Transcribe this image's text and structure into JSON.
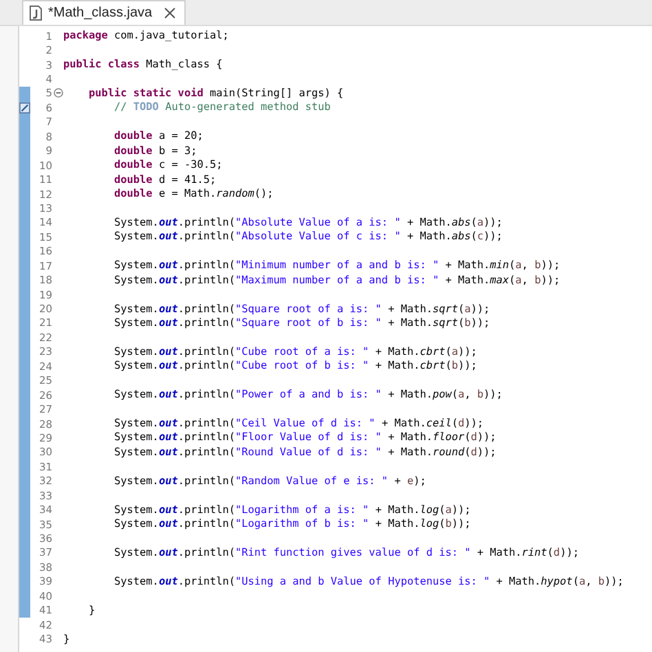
{
  "tabs": [
    {
      "label": "*Math_class.java",
      "selected": true
    }
  ],
  "lines": [
    {
      "number": "1",
      "changed": false,
      "tokens": [
        {
          "kind": "kw",
          "text": "package"
        },
        {
          "kind": "plain",
          "text": " com.java_tutorial;"
        }
      ]
    },
    {
      "number": "2",
      "changed": false
    },
    {
      "number": "3",
      "changed": false,
      "tokens": [
        {
          "kind": "kw",
          "text": "public class"
        },
        {
          "kind": "plain",
          "text": " Math_class {"
        }
      ]
    },
    {
      "number": "4",
      "changed": false
    },
    {
      "number": "5",
      "changed": true,
      "fold": true,
      "tokens": [
        {
          "kind": "kw",
          "text": "\tpublic static void"
        },
        {
          "kind": "plain",
          "text": " main(String[] args) {"
        }
      ]
    },
    {
      "number": "6",
      "changed": true,
      "task": true,
      "tokens": [
        {
          "kind": "comment",
          "text": "\t\t// "
        },
        {
          "kind": "task",
          "text": "TODO"
        },
        {
          "kind": "comment",
          "text": " Auto-generated method stub"
        }
      ]
    },
    {
      "number": "7",
      "changed": true
    },
    {
      "number": "8",
      "changed": true,
      "tokens": [
        {
          "kind": "kw",
          "text": "\t\tdouble"
        },
        {
          "kind": "plain",
          "text": " a = 20;"
        }
      ]
    },
    {
      "number": "9",
      "changed": true,
      "tokens": [
        {
          "kind": "kw",
          "text": "\t\tdouble"
        },
        {
          "kind": "plain",
          "text": " b = 3;"
        }
      ]
    },
    {
      "number": "10",
      "changed": true,
      "tokens": [
        {
          "kind": "kw",
          "text": "\t\tdouble"
        },
        {
          "kind": "plain",
          "text": " c = -30.5;"
        }
      ]
    },
    {
      "number": "11",
      "changed": true,
      "tokens": [
        {
          "kind": "kw",
          "text": "\t\tdouble"
        },
        {
          "kind": "plain",
          "text": " d = 41.5;"
        }
      ]
    },
    {
      "number": "12",
      "changed": true,
      "tokens": [
        {
          "kind": "kw",
          "text": "\t\tdouble"
        },
        {
          "kind": "plain",
          "text": " e = Math."
        },
        {
          "kind": "method",
          "text": "random"
        },
        {
          "kind": "plain",
          "text": "();"
        }
      ]
    },
    {
      "number": "13",
      "changed": true
    },
    {
      "number": "14",
      "changed": true,
      "tokens": [
        {
          "kind": "plain",
          "text": "\t\tSystem."
        },
        {
          "kind": "field",
          "text": "out"
        },
        {
          "kind": "plain",
          "text": ".println("
        },
        {
          "kind": "str",
          "text": "\"Absolute Value of a is: \""
        },
        {
          "kind": "plain",
          "text": " + Math."
        },
        {
          "kind": "method",
          "text": "abs"
        },
        {
          "kind": "plain",
          "text": "("
        },
        {
          "kind": "var",
          "text": "a"
        },
        {
          "kind": "plain",
          "text": "));"
        }
      ]
    },
    {
      "number": "15",
      "changed": true,
      "tokens": [
        {
          "kind": "plain",
          "text": "\t\tSystem."
        },
        {
          "kind": "field",
          "text": "out"
        },
        {
          "kind": "plain",
          "text": ".println("
        },
        {
          "kind": "str",
          "text": "\"Absolute Value of c is: \""
        },
        {
          "kind": "plain",
          "text": " + Math."
        },
        {
          "kind": "method",
          "text": "abs"
        },
        {
          "kind": "plain",
          "text": "("
        },
        {
          "kind": "var",
          "text": "c"
        },
        {
          "kind": "plain",
          "text": "));"
        }
      ]
    },
    {
      "number": "16",
      "changed": true
    },
    {
      "number": "17",
      "changed": true,
      "tokens": [
        {
          "kind": "plain",
          "text": "\t\tSystem."
        },
        {
          "kind": "field",
          "text": "out"
        },
        {
          "kind": "plain",
          "text": ".println("
        },
        {
          "kind": "str",
          "text": "\"Minimum number of a and b is: \""
        },
        {
          "kind": "plain",
          "text": " + Math."
        },
        {
          "kind": "method",
          "text": "min"
        },
        {
          "kind": "plain",
          "text": "("
        },
        {
          "kind": "var",
          "text": "a"
        },
        {
          "kind": "plain",
          "text": ", "
        },
        {
          "kind": "var",
          "text": "b"
        },
        {
          "kind": "plain",
          "text": "));"
        }
      ]
    },
    {
      "number": "18",
      "changed": true,
      "tokens": [
        {
          "kind": "plain",
          "text": "\t\tSystem."
        },
        {
          "kind": "field",
          "text": "out"
        },
        {
          "kind": "plain",
          "text": ".println("
        },
        {
          "kind": "str",
          "text": "\"Maximum number of a and b is: \""
        },
        {
          "kind": "plain",
          "text": " + Math."
        },
        {
          "kind": "method",
          "text": "max"
        },
        {
          "kind": "plain",
          "text": "("
        },
        {
          "kind": "var",
          "text": "a"
        },
        {
          "kind": "plain",
          "text": ", "
        },
        {
          "kind": "var",
          "text": "b"
        },
        {
          "kind": "plain",
          "text": "));"
        }
      ]
    },
    {
      "number": "19",
      "changed": true
    },
    {
      "number": "20",
      "changed": true,
      "tokens": [
        {
          "kind": "plain",
          "text": "\t\tSystem."
        },
        {
          "kind": "field",
          "text": "out"
        },
        {
          "kind": "plain",
          "text": ".println("
        },
        {
          "kind": "str",
          "text": "\"Square root of a is: \""
        },
        {
          "kind": "plain",
          "text": " + Math."
        },
        {
          "kind": "method",
          "text": "sqrt"
        },
        {
          "kind": "plain",
          "text": "("
        },
        {
          "kind": "var",
          "text": "a"
        },
        {
          "kind": "plain",
          "text": "));"
        }
      ]
    },
    {
      "number": "21",
      "changed": true,
      "tokens": [
        {
          "kind": "plain",
          "text": "\t\tSystem."
        },
        {
          "kind": "field",
          "text": "out"
        },
        {
          "kind": "plain",
          "text": ".println("
        },
        {
          "kind": "str",
          "text": "\"Square root of b is: \""
        },
        {
          "kind": "plain",
          "text": " + Math."
        },
        {
          "kind": "method",
          "text": "sqrt"
        },
        {
          "kind": "plain",
          "text": "("
        },
        {
          "kind": "var",
          "text": "b"
        },
        {
          "kind": "plain",
          "text": "));"
        }
      ]
    },
    {
      "number": "22",
      "changed": true
    },
    {
      "number": "23",
      "changed": true,
      "tokens": [
        {
          "kind": "plain",
          "text": "\t\tSystem."
        },
        {
          "kind": "field",
          "text": "out"
        },
        {
          "kind": "plain",
          "text": ".println("
        },
        {
          "kind": "str",
          "text": "\"Cube root of a is: \""
        },
        {
          "kind": "plain",
          "text": " + Math."
        },
        {
          "kind": "method",
          "text": "cbrt"
        },
        {
          "kind": "plain",
          "text": "("
        },
        {
          "kind": "var",
          "text": "a"
        },
        {
          "kind": "plain",
          "text": "));"
        }
      ]
    },
    {
      "number": "24",
      "changed": true,
      "tokens": [
        {
          "kind": "plain",
          "text": "\t\tSystem."
        },
        {
          "kind": "field",
          "text": "out"
        },
        {
          "kind": "plain",
          "text": ".println("
        },
        {
          "kind": "str",
          "text": "\"Cube root of b is: \""
        },
        {
          "kind": "plain",
          "text": " + Math."
        },
        {
          "kind": "method",
          "text": "cbrt"
        },
        {
          "kind": "plain",
          "text": "("
        },
        {
          "kind": "var",
          "text": "b"
        },
        {
          "kind": "plain",
          "text": "));"
        }
      ]
    },
    {
      "number": "25",
      "changed": true
    },
    {
      "number": "26",
      "changed": true,
      "tokens": [
        {
          "kind": "plain",
          "text": "\t\tSystem."
        },
        {
          "kind": "field",
          "text": "out"
        },
        {
          "kind": "plain",
          "text": ".println("
        },
        {
          "kind": "str",
          "text": "\"Power of a and b is: \""
        },
        {
          "kind": "plain",
          "text": " + Math."
        },
        {
          "kind": "method",
          "text": "pow"
        },
        {
          "kind": "plain",
          "text": "("
        },
        {
          "kind": "var",
          "text": "a"
        },
        {
          "kind": "plain",
          "text": ", "
        },
        {
          "kind": "var",
          "text": "b"
        },
        {
          "kind": "plain",
          "text": "));"
        }
      ]
    },
    {
      "number": "27",
      "changed": true
    },
    {
      "number": "28",
      "changed": true,
      "tokens": [
        {
          "kind": "plain",
          "text": "\t\tSystem."
        },
        {
          "kind": "field",
          "text": "out"
        },
        {
          "kind": "plain",
          "text": ".println("
        },
        {
          "kind": "str",
          "text": "\"Ceil Value of d is: \""
        },
        {
          "kind": "plain",
          "text": " + Math."
        },
        {
          "kind": "method",
          "text": "ceil"
        },
        {
          "kind": "plain",
          "text": "("
        },
        {
          "kind": "var",
          "text": "d"
        },
        {
          "kind": "plain",
          "text": "));"
        }
      ]
    },
    {
      "number": "29",
      "changed": true,
      "tokens": [
        {
          "kind": "plain",
          "text": "\t\tSystem."
        },
        {
          "kind": "field",
          "text": "out"
        },
        {
          "kind": "plain",
          "text": ".println("
        },
        {
          "kind": "str",
          "text": "\"Floor Value of d is: \""
        },
        {
          "kind": "plain",
          "text": " + Math."
        },
        {
          "kind": "method",
          "text": "floor"
        },
        {
          "kind": "plain",
          "text": "("
        },
        {
          "kind": "var",
          "text": "d"
        },
        {
          "kind": "plain",
          "text": "));"
        }
      ]
    },
    {
      "number": "30",
      "changed": true,
      "tokens": [
        {
          "kind": "plain",
          "text": "\t\tSystem."
        },
        {
          "kind": "field",
          "text": "out"
        },
        {
          "kind": "plain",
          "text": ".println("
        },
        {
          "kind": "str",
          "text": "\"Round Value of d is: \""
        },
        {
          "kind": "plain",
          "text": " + Math."
        },
        {
          "kind": "method",
          "text": "round"
        },
        {
          "kind": "plain",
          "text": "("
        },
        {
          "kind": "var",
          "text": "d"
        },
        {
          "kind": "plain",
          "text": "));"
        }
      ]
    },
    {
      "number": "31",
      "changed": true
    },
    {
      "number": "32",
      "changed": true,
      "tokens": [
        {
          "kind": "plain",
          "text": "\t\tSystem."
        },
        {
          "kind": "field",
          "text": "out"
        },
        {
          "kind": "plain",
          "text": ".println("
        },
        {
          "kind": "str",
          "text": "\"Random Value of e is: \""
        },
        {
          "kind": "plain",
          "text": " + "
        },
        {
          "kind": "var",
          "text": "e"
        },
        {
          "kind": "plain",
          "text": ");"
        }
      ]
    },
    {
      "number": "33",
      "changed": true
    },
    {
      "number": "34",
      "changed": true,
      "tokens": [
        {
          "kind": "plain",
          "text": "\t\tSystem."
        },
        {
          "kind": "field",
          "text": "out"
        },
        {
          "kind": "plain",
          "text": ".println("
        },
        {
          "kind": "str",
          "text": "\"Logarithm of a is: \""
        },
        {
          "kind": "plain",
          "text": " + Math."
        },
        {
          "kind": "method",
          "text": "log"
        },
        {
          "kind": "plain",
          "text": "("
        },
        {
          "kind": "var",
          "text": "a"
        },
        {
          "kind": "plain",
          "text": "));"
        }
      ]
    },
    {
      "number": "35",
      "changed": true,
      "tokens": [
        {
          "kind": "plain",
          "text": "\t\tSystem."
        },
        {
          "kind": "field",
          "text": "out"
        },
        {
          "kind": "plain",
          "text": ".println("
        },
        {
          "kind": "str",
          "text": "\"Logarithm of b is: \""
        },
        {
          "kind": "plain",
          "text": " + Math."
        },
        {
          "kind": "method",
          "text": "log"
        },
        {
          "kind": "plain",
          "text": "("
        },
        {
          "kind": "var",
          "text": "b"
        },
        {
          "kind": "plain",
          "text": "));"
        }
      ]
    },
    {
      "number": "36",
      "changed": true
    },
    {
      "number": "37",
      "changed": true,
      "tokens": [
        {
          "kind": "plain",
          "text": "\t\tSystem."
        },
        {
          "kind": "field",
          "text": "out"
        },
        {
          "kind": "plain",
          "text": ".println("
        },
        {
          "kind": "str",
          "text": "\"Rint function gives value of d is: \""
        },
        {
          "kind": "plain",
          "text": " + Math."
        },
        {
          "kind": "method",
          "text": "rint"
        },
        {
          "kind": "plain",
          "text": "("
        },
        {
          "kind": "var",
          "text": "d"
        },
        {
          "kind": "plain",
          "text": "));"
        }
      ]
    },
    {
      "number": "38",
      "changed": true
    },
    {
      "number": "39",
      "changed": true,
      "tokens": [
        {
          "kind": "plain",
          "text": "\t\tSystem."
        },
        {
          "kind": "field",
          "text": "out"
        },
        {
          "kind": "plain",
          "text": ".println("
        },
        {
          "kind": "str",
          "text": "\"Using a and b Value of Hypotenuse is: \""
        },
        {
          "kind": "plain",
          "text": " + Math."
        },
        {
          "kind": "method",
          "text": "hypot"
        },
        {
          "kind": "plain",
          "text": "("
        },
        {
          "kind": "var",
          "text": "a"
        },
        {
          "kind": "plain",
          "text": ", "
        },
        {
          "kind": "var",
          "text": "b"
        },
        {
          "kind": "plain",
          "text": "));"
        }
      ]
    },
    {
      "number": "40",
      "changed": true
    },
    {
      "number": "41",
      "changed": true,
      "tokens": [
        {
          "kind": "plain",
          "text": "\t}"
        }
      ]
    },
    {
      "number": "42",
      "changed": false
    },
    {
      "number": "43",
      "changed": false,
      "tokens": [
        {
          "kind": "plain",
          "text": "}"
        }
      ]
    }
  ]
}
